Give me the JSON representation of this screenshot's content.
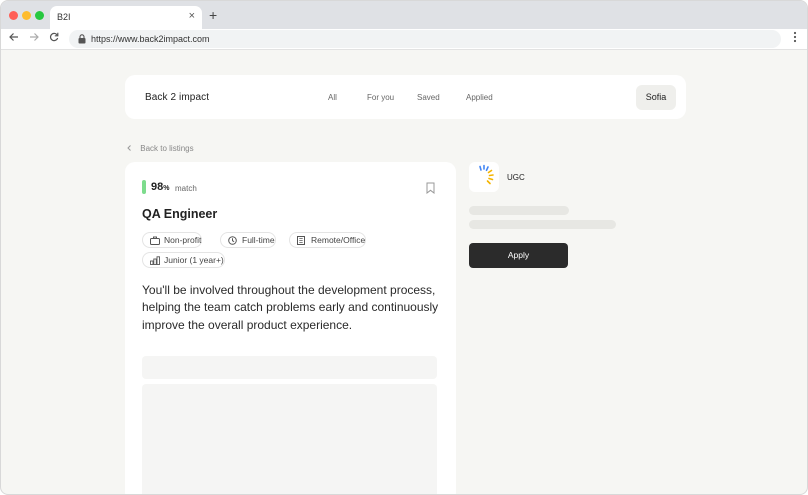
{
  "browser": {
    "tab_title": "B2I",
    "tab_close": "×",
    "new_tab": "+",
    "url": "https://www.back2impact.com",
    "icons": [
      "back-arrow-icon",
      "forward-arrow-icon",
      "reload-icon",
      "lock-icon",
      "more-vert-icon"
    ]
  },
  "header": {
    "brand": "Back 2 impact",
    "nav": [
      "All",
      "For you",
      "Saved",
      "Applied"
    ],
    "user": "Sofia"
  },
  "back_link": "Back to listings",
  "job": {
    "match_value": "98",
    "match_percent": "%",
    "match_word": "match",
    "title": "QA Engineer",
    "tags": [
      {
        "label": "Non-profit",
        "icon": "briefcase-icon"
      },
      {
        "label": "Full-time",
        "icon": "clock-icon"
      },
      {
        "label": "Remote/Office",
        "icon": "building-icon"
      },
      {
        "label": "Junior (1 year+)",
        "icon": "seniority-icon"
      }
    ],
    "description": "You'll be involved throughout the development process, helping the team catch problems early and continuously improve the overall product experience."
  },
  "company": {
    "name": "UGC"
  },
  "apply_label": "Apply",
  "colors": {
    "page_bg": "#f6f6f3",
    "match_bar": "#7ddc8d",
    "apply_bg": "#2b2b2b",
    "logo_blue": "#4285f4",
    "logo_yellow": "#f4b400"
  }
}
